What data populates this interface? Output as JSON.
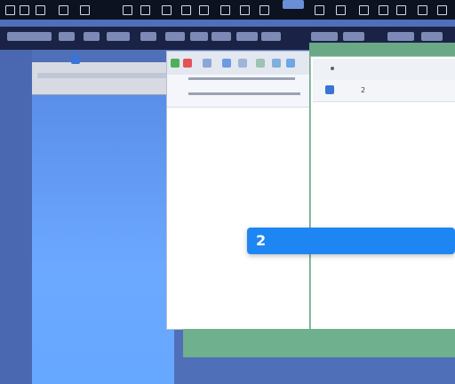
{
  "top_strip": {
    "icons": [
      "app-icon",
      "app-icon",
      "app-icon",
      "app-icon",
      "app-icon",
      "app-icon",
      "app-icon",
      "app-icon",
      "app-icon",
      "app-icon",
      "app-icon",
      "app-icon",
      "app-icon",
      "app-icon",
      "app-icon",
      "app-icon",
      "app-icon",
      "app-icon",
      "app-icon",
      "app-icon",
      "app-icon"
    ]
  },
  "doc_window": {
    "path_text": "",
    "subline_text": ""
  },
  "right_pane": {
    "header_text": "",
    "sub_index": "2",
    "sub_label": "",
    "heading": "",
    "paragraph_1": "",
    "paragraph_2": ""
  },
  "toast": {
    "number": "2",
    "message": ""
  },
  "colors": {
    "accent": "#1e86f2",
    "pane_green": "#6aa886",
    "desktop_blue": "#5a8ee8",
    "toolbar_dark": "#1a2345"
  }
}
